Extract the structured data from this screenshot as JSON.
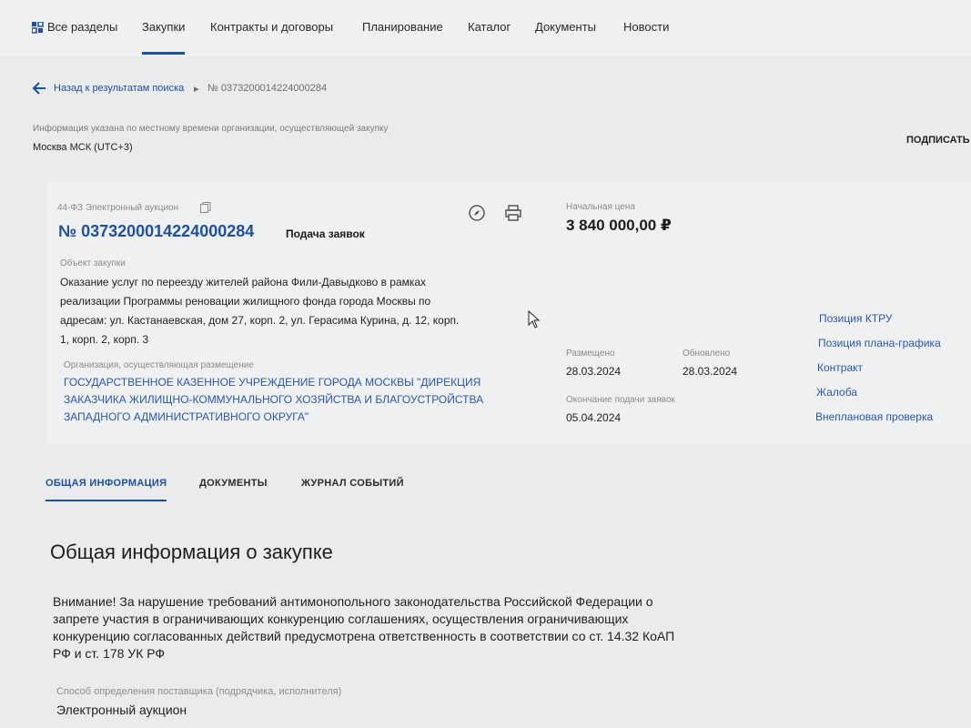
{
  "nav": {
    "items": [
      {
        "label": "Все разделы",
        "icon": "grid-icon"
      },
      {
        "label": "Закупки",
        "active": true
      },
      {
        "label": "Контракты и договоры"
      },
      {
        "label": "Планирование"
      },
      {
        "label": "Каталог"
      },
      {
        "label": "Документы"
      },
      {
        "label": "Новости"
      }
    ]
  },
  "breadcrumb": {
    "back_label": "Назад к результатам поиска",
    "separator": "▸",
    "current": "№ 0373200014224000284"
  },
  "timezone": {
    "note": "Информация указана по местному времени организации, осуществляющей закупку",
    "value": "Москва МСК (UTC+3)"
  },
  "subscribe_label": "ПОДПИСАТЬ",
  "purchase": {
    "law_type": "44-ФЗ Электронный аукцион",
    "number": "№ 0373200014224000284",
    "stage": "Подача заявок",
    "object_label": "Объект закупки",
    "object_text": "Оказание услуг по переезду жителей района Фили-Давыдково в рамках реализации Программы реновации жилищного фонда города Москвы по адресам: ул. Кастанаевская, дом 27, корп. 2, ул. Герасима Курина, д. 12, корп. 1, корп. 2, корп. 3",
    "org_label": "Организация, осуществляющая размещение",
    "org_name": "ГОСУДАРСТВЕННОЕ КАЗЕННОЕ УЧРЕЖДЕНИЕ ГОРОДА МОСКВЫ \"ДИРЕКЦИЯ ЗАКАЗЧИКА ЖИЛИЩНО-КОММУНАЛЬНОГО ХОЗЯЙСТВА И БЛАГОУСТРОЙСТВА ЗАПАДНОГО АДМИНИСТРАТИВНОГО ОКРУГА\"",
    "price_label": "Начальная цена",
    "price": "3 840 000,00 ₽",
    "posted_label": "Размещено",
    "posted": "28.03.2024",
    "updated_label": "Обновлено",
    "updated": "28.03.2024",
    "deadline_label": "Окончание подачи заявок",
    "deadline": "05.04.2024"
  },
  "side_links": [
    "Позиция КТРУ",
    "Позиция плана-графика",
    "Контракт",
    "Жалоба",
    "Внеплановая проверка"
  ],
  "tabs": [
    "ОБЩАЯ ИНФОРМАЦИЯ",
    "ДОКУМЕНТЫ",
    "ЖУРНАЛ СОБЫТИЙ"
  ],
  "section": {
    "title": "Общая информация о закупке",
    "warning": "Внимание! За нарушение требований антимонопольного законодательства Российской Федерации о запрете участия в ограничивающих конкуренцию соглашениях, осуществления ограничивающих конкуренцию согласованных действий предусмотрена ответственность в соответствии со ст. 14.32 КоАП РФ и ст. 178 УК РФ",
    "method_label": "Способ определения поставщика (подрядчика, исполнителя)",
    "method_value": "Электронный аукцион"
  },
  "colors": {
    "accent": "#1f4fa3",
    "link": "#2b57b0",
    "background": "#e9ebed"
  }
}
